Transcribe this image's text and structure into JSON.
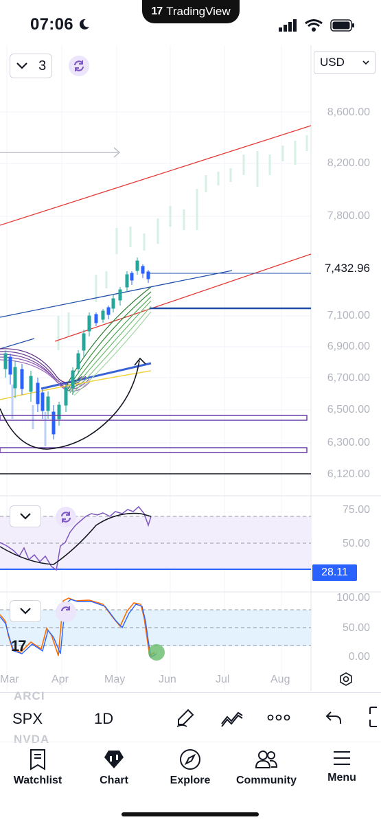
{
  "status_bar": {
    "time": "07:06",
    "app_brand": "TradingView"
  },
  "chart_header": {
    "interval_count": "3",
    "currency": "USD"
  },
  "price_axis": [
    "8,600.00",
    "8,200.00",
    "7,800.00",
    "7,100.00",
    "6,900.00",
    "6,700.00",
    "6,500.00",
    "6,300.00",
    "6,120.00"
  ],
  "current_price": "7,432.96",
  "rsi_axis": [
    "75.00",
    "50.00"
  ],
  "rsi_value": "28.11",
  "stoch_axis": [
    "100.00",
    "50.00",
    "0.00"
  ],
  "time_axis": [
    "Mar",
    "Apr",
    "May",
    "Jun",
    "Jul",
    "Aug"
  ],
  "bottom_toolbar": {
    "symbol": "SPX",
    "interval": "1D"
  },
  "watchlist_ghosts": [
    "ARCI",
    "NVDA"
  ],
  "nav": {
    "watchlist": "Watchlist",
    "chart": "Chart",
    "explore": "Explore",
    "community": "Community",
    "menu": "Menu"
  },
  "colors": {
    "accent": "#2962ff",
    "up": "#26a69a",
    "down": "#2962ff",
    "channel": "#e53935",
    "rsi_fill": "#f3eefc",
    "stoch_fill": "#e3f2fd"
  }
}
